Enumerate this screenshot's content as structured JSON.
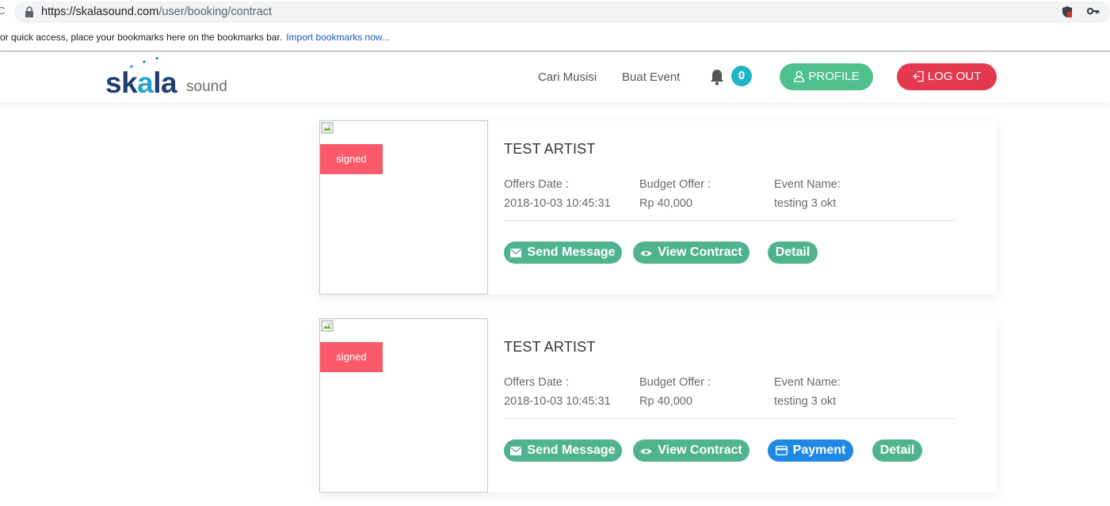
{
  "browser": {
    "reload_fragment": "C",
    "url_host": "https://skalasound.com",
    "url_path": "/user/booking/contract",
    "bookmarks_text": "or quick access, place your bookmarks here on the bookmarks bar.",
    "bookmarks_link": "Import bookmarks now..."
  },
  "logo": {
    "pre": "sk",
    "highlight": "a",
    "post": "la",
    "sub": "sound",
    "color_primary": "#1f3c73",
    "color_accent": "#27a3c9"
  },
  "nav": {
    "links": [
      "Cari Musisi",
      "Buat Event"
    ],
    "notification_count": "0",
    "profile_label": "PROFILE",
    "logout_label": "LOG OUT",
    "colors": {
      "profile": "#4fc18f",
      "logout": "#e5394f",
      "badge": "#20b6c8"
    }
  },
  "bookings": [
    {
      "status": "signed",
      "artist": "TEST ARTIST",
      "offers_date_label": "Offers Date :",
      "offers_date": "2018-10-03 10:45:31",
      "budget_label": "Budget Offer :",
      "budget": "Rp 40,000",
      "event_label": "Event Name:",
      "event": "testing 3 okt",
      "actions": [
        "Send Message",
        "View Contract",
        "Detail"
      ]
    },
    {
      "status": "signed",
      "artist": "TEST ARTIST",
      "offers_date_label": "Offers Date :",
      "offers_date": "2018-10-03 10:45:31",
      "budget_label": "Budget Offer :",
      "budget": "Rp 40,000",
      "event_label": "Event Name:",
      "event": "testing 3 okt",
      "actions": [
        "Send Message",
        "View Contract",
        "Payment",
        "Detail"
      ]
    }
  ],
  "colors": {
    "status_badge": "#fb5a6b",
    "action_green": "#4fb48e",
    "action_blue": "#1f88e5"
  }
}
